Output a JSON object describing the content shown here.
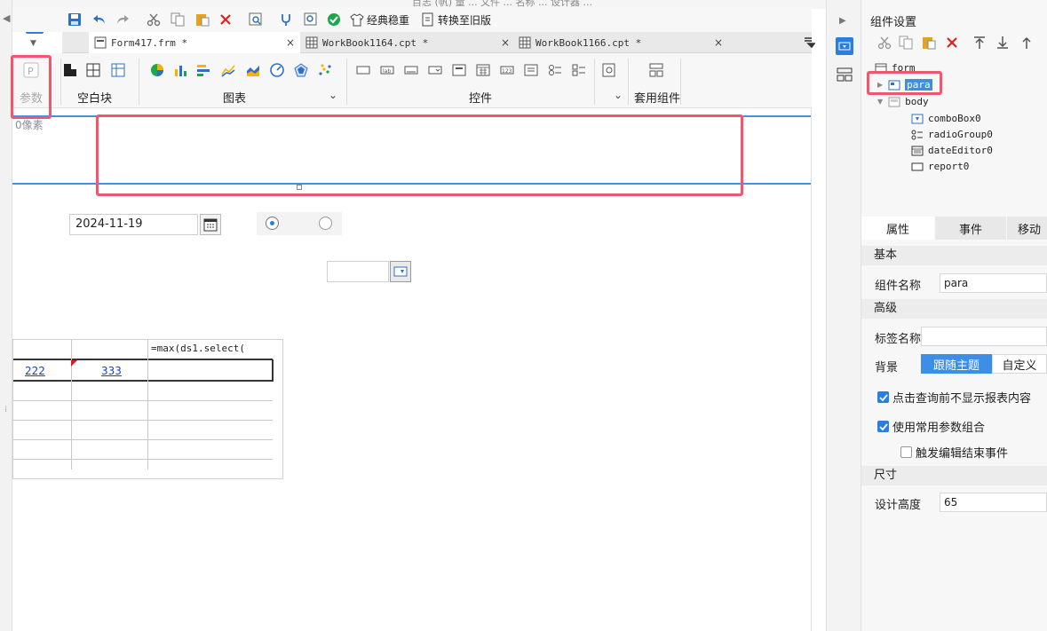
{
  "window": {
    "title_fragment": "目志 (帆) 量 ... 文件 ... 名称 ... 设计器 ..."
  },
  "toolbar": {
    "classic_label": "经典稳重",
    "convert_label": "转换至旧版"
  },
  "tabs": [
    {
      "label": "Form417.frm *",
      "active": true
    },
    {
      "label": "WorkBook1164.cpt *",
      "active": false
    },
    {
      "label": "WorkBook1166.cpt *",
      "active": false
    }
  ],
  "tab_close": "×",
  "palette": {
    "param_label": "参数",
    "blank_label": "空白块",
    "chart_label": "图表",
    "controls_label": "控件",
    "template_label": "套用组件"
  },
  "canvas": {
    "pixel_label": "0像素",
    "date_value": "2024-11-19",
    "report": {
      "header": [
        "",
        "",
        "=max(ds1.select("
      ],
      "rows": [
        [
          "222",
          "333",
          ""
        ]
      ]
    }
  },
  "panel": {
    "title": "组件设置",
    "tree": {
      "root": "form",
      "para": "para",
      "body": "body",
      "children": [
        "comboBox0",
        "radioGroup0",
        "dateEditor0",
        "report0"
      ]
    },
    "tabs": [
      "属性",
      "事件",
      "移动"
    ],
    "sections": {
      "basic": "基本",
      "advanced": "高级",
      "size": "尺寸"
    },
    "fields": {
      "name_label": "组件名称",
      "name_value": "para",
      "tag_label": "标签名称",
      "tag_value": "",
      "bg_label": "背景",
      "bg_follow": "跟随主题",
      "bg_custom": "自定义",
      "height_label": "设计高度",
      "height_value": "65"
    },
    "checkboxes": [
      {
        "label": "点击查询前不显示报表内容",
        "checked": true
      },
      {
        "label": "使用常用参数组合",
        "checked": true
      },
      {
        "label": "触发编辑结束事件",
        "checked": false
      }
    ]
  },
  "colors": {
    "accent": "#2a7de1",
    "highlight": "#f0566e",
    "band": "#4a90d9",
    "link": "#1a3fcf"
  }
}
